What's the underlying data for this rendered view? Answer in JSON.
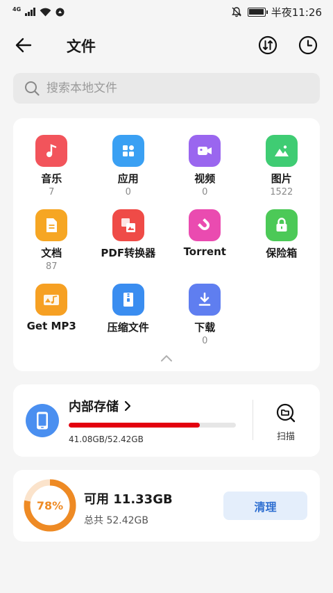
{
  "status_bar": {
    "network": "4G",
    "time": "半夜11:26"
  },
  "header": {
    "title": "文件"
  },
  "search": {
    "placeholder": "搜索本地文件"
  },
  "categories": [
    {
      "label": "音乐",
      "count": "7",
      "icon": "music-icon",
      "color": "#f2545b"
    },
    {
      "label": "应用",
      "count": "0",
      "icon": "apps-icon",
      "color": "#3aa0f3"
    },
    {
      "label": "视频",
      "count": "0",
      "icon": "video-icon",
      "color": "#9a66ef"
    },
    {
      "label": "图片",
      "count": "1522",
      "icon": "image-icon",
      "color": "#3fcc73"
    },
    {
      "label": "文档",
      "count": "87",
      "icon": "document-icon",
      "color": "#f6a623"
    },
    {
      "label": "PDF转换器",
      "count": "",
      "icon": "pdf-converter-icon",
      "color": "#ef4b47"
    },
    {
      "label": "Torrent",
      "count": "",
      "icon": "torrent-magnet-icon",
      "color": "#ea4bb0"
    },
    {
      "label": "保险箱",
      "count": "",
      "icon": "lock-icon",
      "color": "#4cc957"
    },
    {
      "label": "Get MP3",
      "count": "",
      "icon": "get-mp3-icon",
      "color": "#f6a023"
    },
    {
      "label": "压缩文件",
      "count": "",
      "icon": "zip-icon",
      "color": "#3a8df0"
    },
    {
      "label": "下载",
      "count": "0",
      "icon": "download-icon",
      "color": "#5f7ef0"
    }
  ],
  "storage": {
    "title": "内部存储",
    "used_text": "41.08GB/52.42GB",
    "used_fraction": 0.784,
    "scan_label": "扫描"
  },
  "available": {
    "percent_label": "78%",
    "percent": 0.78,
    "title": "可用 11.33GB",
    "total": "总共 52.42GB",
    "clean_label": "清理"
  },
  "colors": {
    "accent_red": "#e3000f",
    "ring_orange": "#ee8a24",
    "button_blue": "#2f6fd1"
  }
}
